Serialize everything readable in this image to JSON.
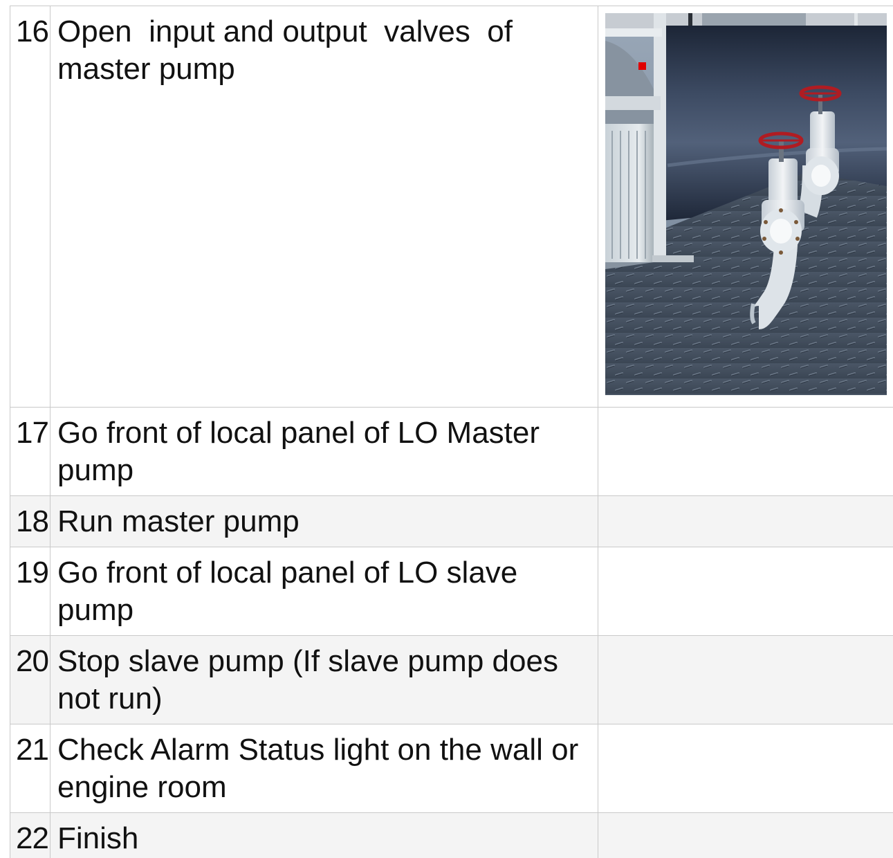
{
  "steps": [
    {
      "num": "16",
      "text": "Open  input and output  valves  of master pump",
      "image": "valves-scene"
    },
    {
      "num": "17",
      "text": "Go front of local panel of LO Master pump"
    },
    {
      "num": "18",
      "text": "Run master pump"
    },
    {
      "num": "19",
      "text": "Go front of local panel of LO slave pump"
    },
    {
      "num": "20",
      "text": "Stop slave pump (If slave pump does not run)"
    },
    {
      "num": "21",
      "text": "Check Alarm Status light on the wall or engine room"
    },
    {
      "num": "22",
      "text": "Finish"
    }
  ],
  "colors": {
    "border": "#c9c9c9",
    "row_alt": "#f4f4f4",
    "valve_wheel": "#b01c22",
    "marker": "#e00000"
  }
}
